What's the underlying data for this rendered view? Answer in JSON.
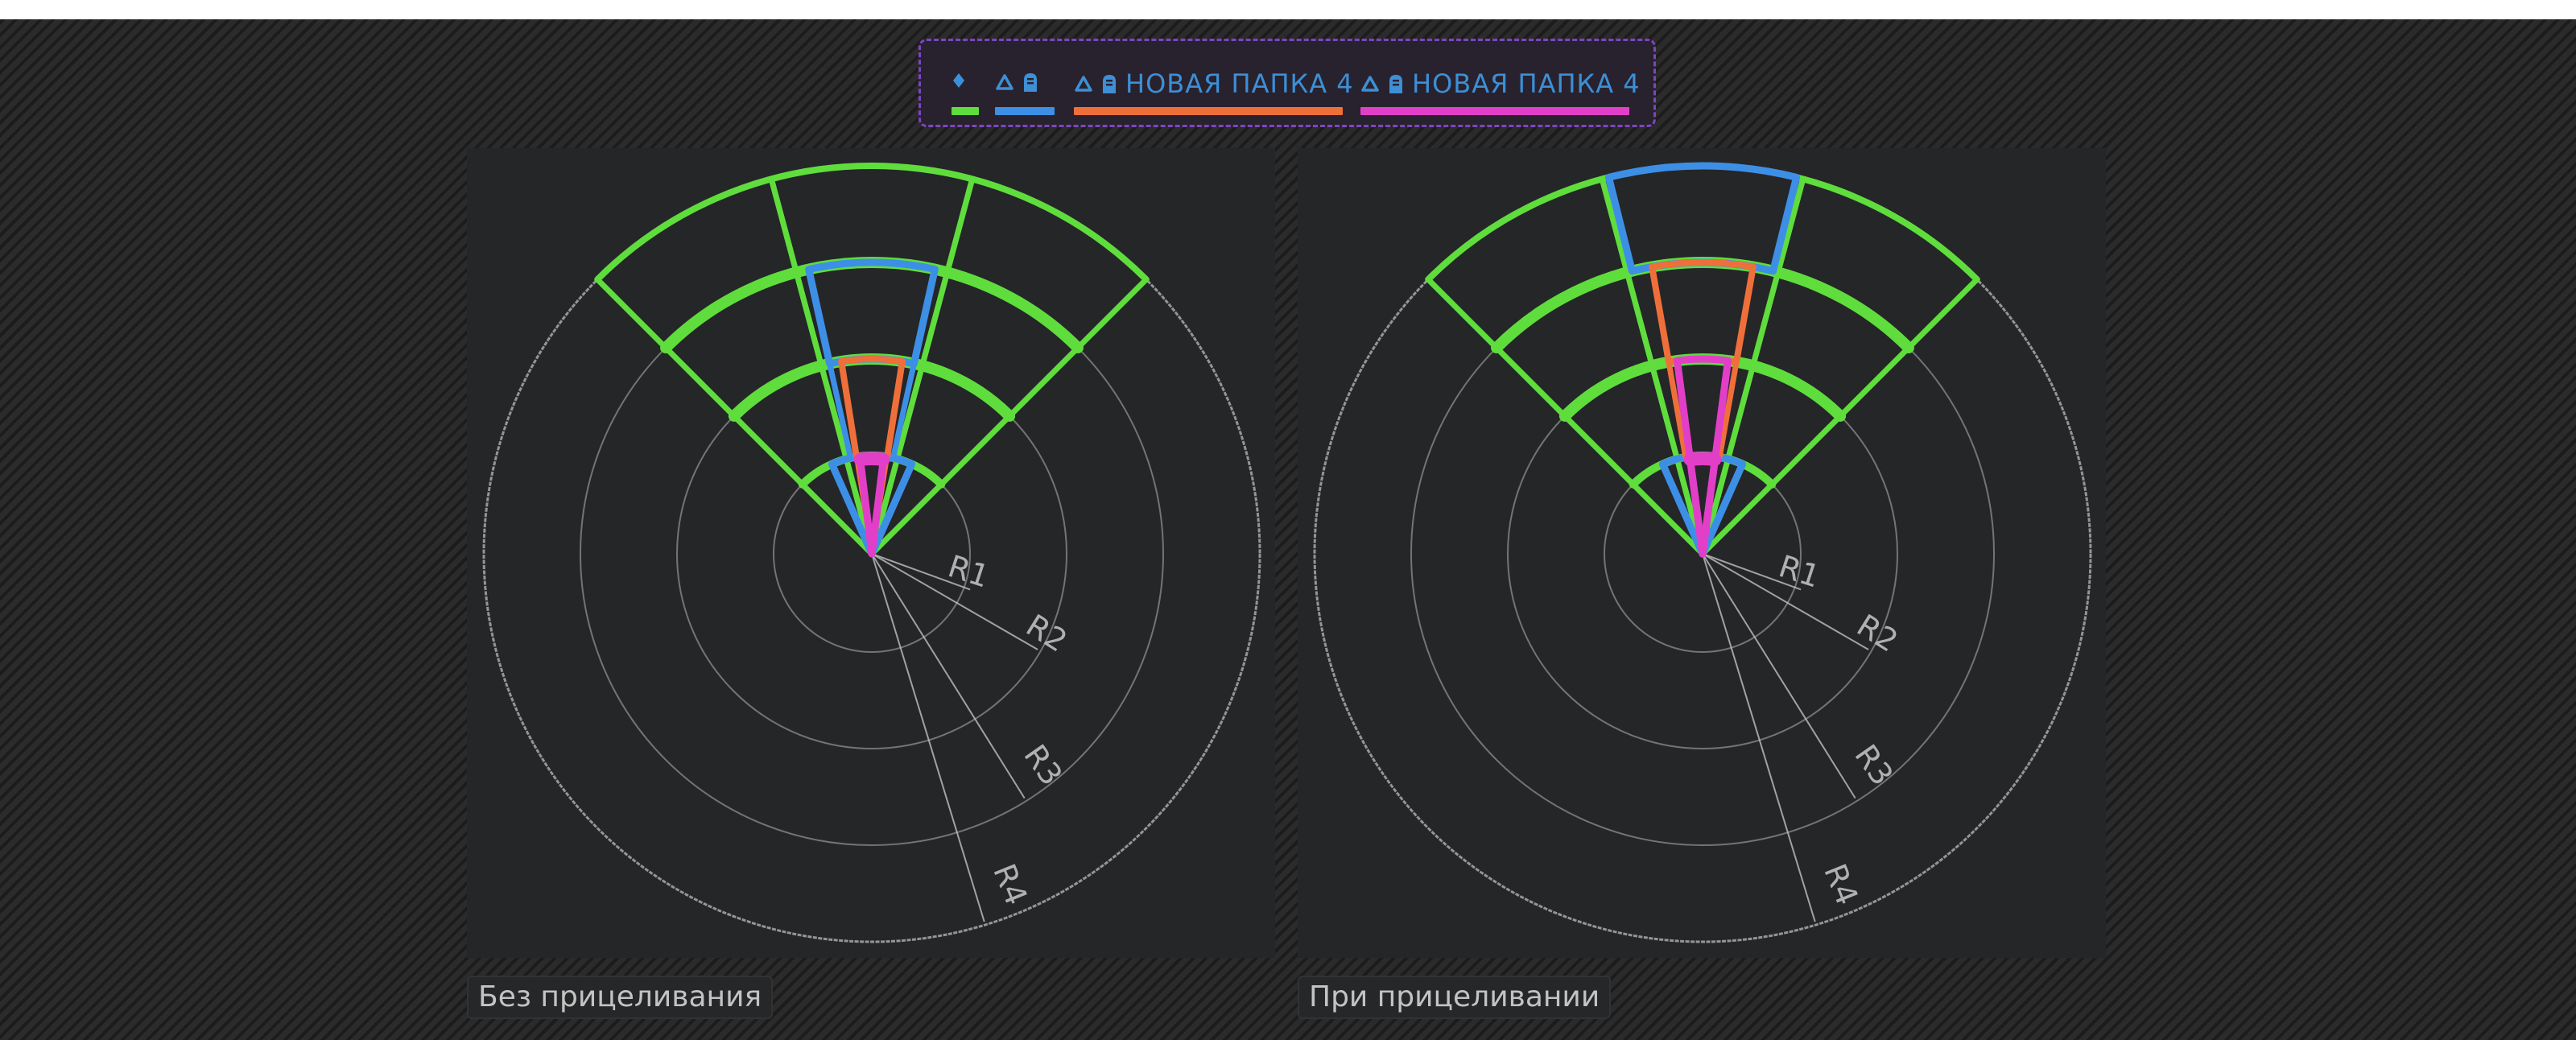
{
  "legend": {
    "items": [
      {
        "icons": [
          "diamond-icon"
        ],
        "label": "",
        "color": "#5fdd3c"
      },
      {
        "icons": [
          "triangle-icon",
          "tombstone-icon"
        ],
        "label": "",
        "color": "#3d8fe6"
      },
      {
        "icons": [
          "triangle-icon",
          "tombstone-icon"
        ],
        "label": "НОВАЯ ПАПКА 4",
        "color": "#ef6f3b"
      },
      {
        "icons": [
          "triangle-icon",
          "tombstone-icon"
        ],
        "label": "НОВАЯ ПАПКА 4",
        "color": "#e23fc8"
      }
    ],
    "icon_color": "#3d8fd6",
    "border_color": "#7d45c2"
  },
  "panels": [
    {
      "caption": "Без прицеливания",
      "variant": "no-aim"
    },
    {
      "caption": "При прицеливании",
      "variant": "aim"
    }
  ],
  "diagram": {
    "radius_labels": [
      "R1",
      "R2",
      "R3",
      "R4"
    ],
    "colors": {
      "green": "#5fdd3c",
      "blue": "#3d8fe6",
      "orange": "#ef6f3b",
      "pink": "#e23fc8",
      "ring": "#a9a9a9",
      "marker": "#c2c2c2"
    }
  }
}
